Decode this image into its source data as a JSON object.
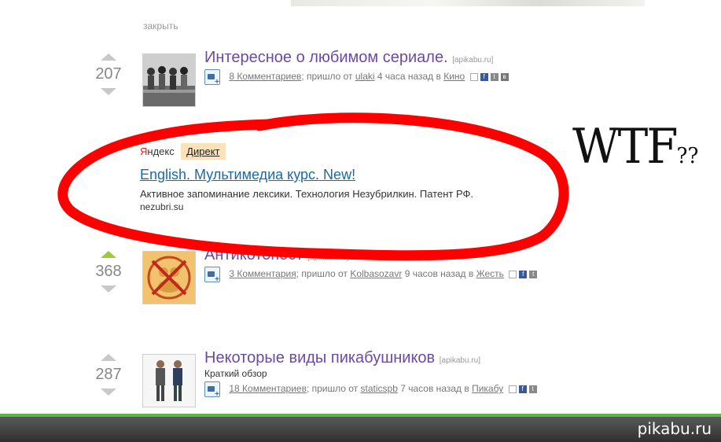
{
  "close_label": "закрыть",
  "posts": [
    {
      "score": "207",
      "title": "Интересное о любимом сериале.",
      "source": "[apikabu.ru]",
      "comments": "8 Комментариев",
      "sep": "; пришло от",
      "author": "ulaki",
      "time": "4 часа назад в",
      "category": "Кино"
    },
    {
      "score": "368",
      "title": "Антикотопост",
      "source": "[apikabu.ru]",
      "comments": "3 Комментария",
      "sep": "; пришло от",
      "author": "Kolbasozavr",
      "time": "9 часов назад в",
      "category": "Жесть"
    },
    {
      "score": "287",
      "title": "Некоторые виды пикабушников",
      "source": "[apikabu.ru]",
      "subtitle": "Краткий обзор",
      "comments": "18 Комментариев",
      "sep": "; пришло от",
      "author": "staticspb",
      "time": "7 часов назад в",
      "category": "Пикабу"
    }
  ],
  "ad": {
    "yandex_y": "Я",
    "yandex_rest": "ндекс",
    "direct": "Директ",
    "title": "English. Мультимедиа курс. New!",
    "text": "Активное запоминание лексики. Технология Незубрилкин. Патент РФ.",
    "domain": "nezubri.su"
  },
  "annotation": {
    "wtf": "WTF",
    "marks": "??"
  },
  "social": {
    "fb": "f",
    "tw": "t",
    "vk": "в"
  },
  "brand": "pikabu.ru",
  "colors": {
    "title": "#6b4aa3",
    "ad_link": "#1a6aa8",
    "highlight": "#ff0000",
    "up_active": "#9ccc3c",
    "brand_line": "#5cb44a"
  }
}
